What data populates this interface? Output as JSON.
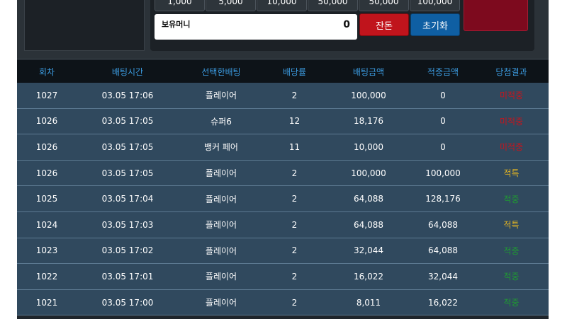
{
  "chips": [
    "1,000",
    "5,000",
    "10,000",
    "50,000",
    "50,000",
    "100,000"
  ],
  "money": {
    "label": "보유머니",
    "value": "0"
  },
  "buttons": {
    "remain": "잔돈",
    "reset": "초기화"
  },
  "colors": {
    "miss": "#c8141c",
    "hit": "#e0b224",
    "green": "#1f9a32",
    "header_text": "#3b9be0",
    "row_bg": "#30495e"
  },
  "table": {
    "headers": [
      "회차",
      "배팅시간",
      "선택한배팅",
      "배당률",
      "배팅금액",
      "적중금액",
      "당첨결과"
    ],
    "rows": [
      {
        "round": "1027",
        "time": "03.05 17:06",
        "bet": "플레이어",
        "odds": "2",
        "amount": "100,000",
        "win": "0",
        "result": "미적중",
        "status": "miss"
      },
      {
        "round": "1026",
        "time": "03.05 17:05",
        "bet": "슈퍼6",
        "odds": "12",
        "amount": "18,176",
        "win": "0",
        "result": "미적중",
        "status": "miss"
      },
      {
        "round": "1026",
        "time": "03.05 17:05",
        "bet": "뱅커 페어",
        "odds": "11",
        "amount": "10,000",
        "win": "0",
        "result": "미적중",
        "status": "miss"
      },
      {
        "round": "1026",
        "time": "03.05 17:05",
        "bet": "플레이어",
        "odds": "2",
        "amount": "100,000",
        "win": "100,000",
        "result": "적특",
        "status": "hit"
      },
      {
        "round": "1025",
        "time": "03.05 17:04",
        "bet": "플레이어",
        "odds": "2",
        "amount": "64,088",
        "win": "128,176",
        "result": "적중",
        "status": "green"
      },
      {
        "round": "1024",
        "time": "03.05 17:03",
        "bet": "플레이어",
        "odds": "2",
        "amount": "64,088",
        "win": "64,088",
        "result": "적특",
        "status": "hit"
      },
      {
        "round": "1023",
        "time": "03.05 17:02",
        "bet": "플레이어",
        "odds": "2",
        "amount": "32,044",
        "win": "64,088",
        "result": "적중",
        "status": "green"
      },
      {
        "round": "1022",
        "time": "03.05 17:01",
        "bet": "플레이어",
        "odds": "2",
        "amount": "16,022",
        "win": "32,044",
        "result": "적중",
        "status": "green"
      },
      {
        "round": "1021",
        "time": "03.05 17:00",
        "bet": "플레이어",
        "odds": "2",
        "amount": "8,011",
        "win": "16,022",
        "result": "적중",
        "status": "green"
      }
    ]
  }
}
